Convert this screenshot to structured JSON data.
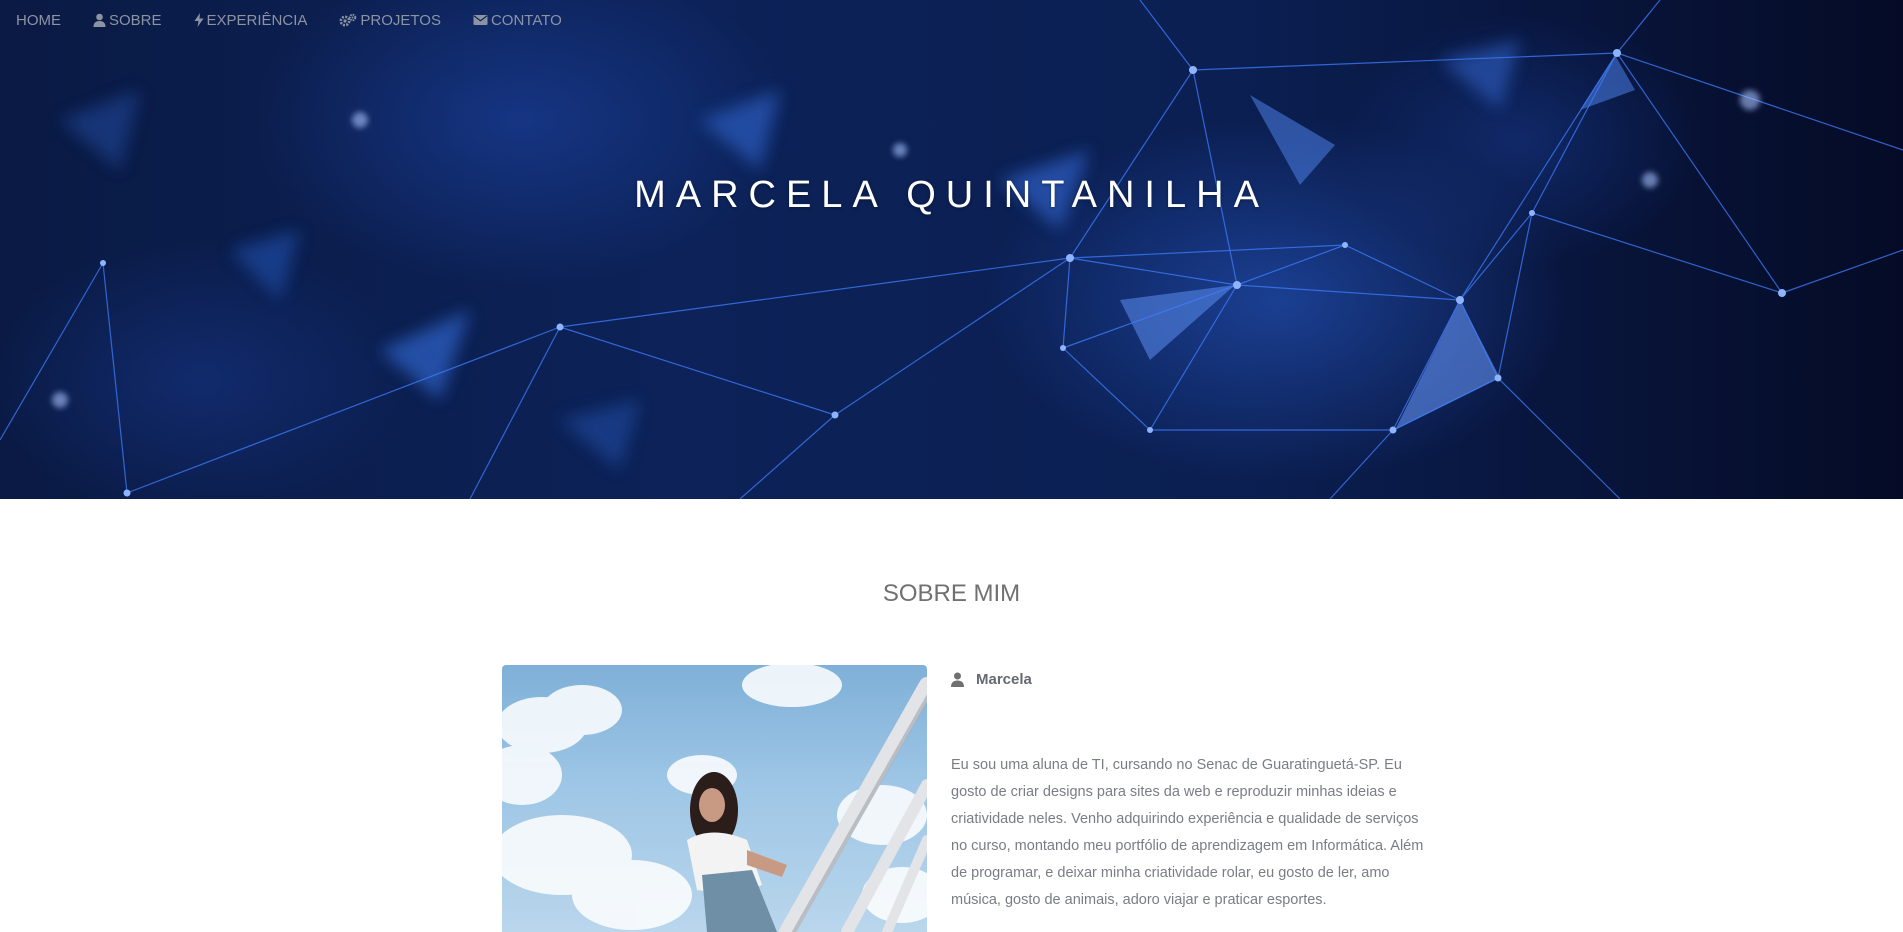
{
  "nav": {
    "items": [
      {
        "label": "HOME",
        "icon": ""
      },
      {
        "label": "SOBRE",
        "icon": "user-icon"
      },
      {
        "label": "EXPERIÊNCIA",
        "icon": "bolt-icon"
      },
      {
        "label": "PROJETOS",
        "icon": "gears-icon"
      },
      {
        "label": "CONTATO",
        "icon": "envelope-icon"
      }
    ]
  },
  "hero": {
    "title": "MARCELA QUINTANILHA"
  },
  "about": {
    "title": "SOBRE MIM",
    "name": "Marcela",
    "bio": "Eu sou uma aluna de TI, cursando no Senac de Guaratinguetá-SP. Eu gosto de criar designs para sites da web e reproduzir minhas ideias e criatividade neles. Venho adquirindo experiência e qualidade de serviços no curso, montando meu portfólio de aprendizagem em Informática. Além de programar, e deixar minha criatividade rolar, eu gosto de ler, amo música, gosto de animais, adoro viajar e praticar esportes."
  },
  "colors": {
    "nav_text": "#8c93a3",
    "hero_bg": "#0b1f52",
    "network_line": "#3f7dff",
    "title_text": "#ffffff",
    "section_title": "#707070",
    "body_text": "#7a7d83"
  }
}
